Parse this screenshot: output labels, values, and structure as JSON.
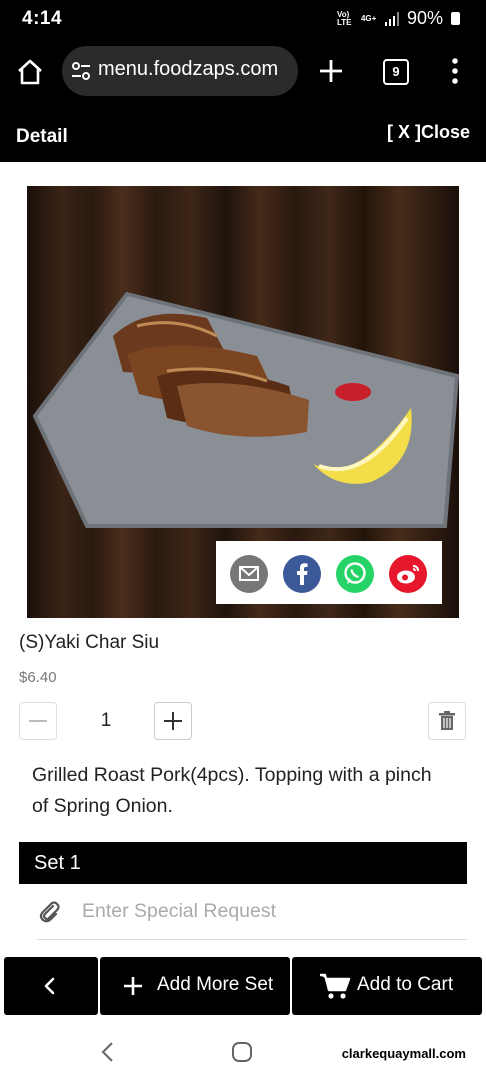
{
  "status_bar": {
    "time": "4:14",
    "network_a": "Vo) LTE",
    "network_b": "4G+",
    "battery": "90%"
  },
  "browser": {
    "url": "menu.foodzaps.com",
    "tab_count": "9"
  },
  "detail_header": {
    "title": "Detail",
    "close_label": "[ X ]Close"
  },
  "item": {
    "name": "(S)Yaki Char Siu",
    "price": "$6.40",
    "quantity": "1",
    "description": "Grilled Roast Pork(4pcs). Topping with a pinch of Spring Onion."
  },
  "share": {
    "icons": [
      "email-icon",
      "facebook-icon",
      "whatsapp-icon",
      "weibo-icon"
    ],
    "colors": {
      "email": "#777777",
      "facebook": "#3b5998",
      "whatsapp": "#25d366",
      "weibo": "#e6162d"
    }
  },
  "set": {
    "label": "Set 1",
    "special_request_placeholder": "Enter Special Request"
  },
  "footer": {
    "add_more_set_label": "Add More Set",
    "add_to_cart_label": "Add to Cart"
  },
  "watermark": "clarkequaymall.com"
}
